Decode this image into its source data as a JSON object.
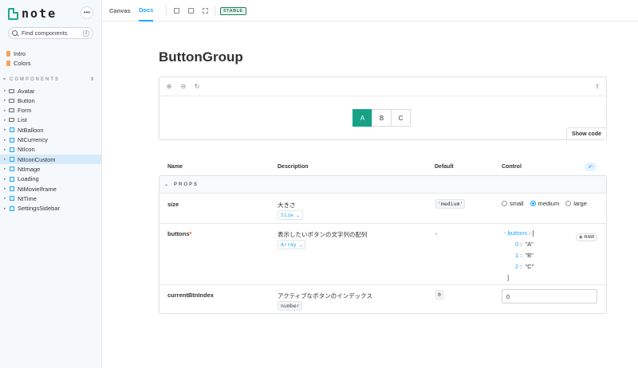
{
  "brand": {
    "name": "note"
  },
  "search": {
    "placeholder": "Find components",
    "shortcut": "/"
  },
  "docs": [
    {
      "label": "Intro"
    },
    {
      "label": "Colors"
    }
  ],
  "sidebar": {
    "section_title": "COMPONENTS",
    "items": [
      {
        "label": "Avatar",
        "type": "folder"
      },
      {
        "label": "Button",
        "type": "folder"
      },
      {
        "label": "Form",
        "type": "folder"
      },
      {
        "label": "List",
        "type": "folder"
      },
      {
        "label": "NtBalloon",
        "type": "component"
      },
      {
        "label": "NtCurrency",
        "type": "component"
      },
      {
        "label": "NtIcon",
        "type": "component"
      },
      {
        "label": "NtIconCustom",
        "type": "component",
        "selected": true
      },
      {
        "label": "NtImage",
        "type": "component"
      },
      {
        "label": "Loading",
        "type": "component"
      },
      {
        "label": "NtMovieIframe",
        "type": "component"
      },
      {
        "label": "NtTime",
        "type": "component"
      },
      {
        "label": "SettingsSidebar",
        "type": "component"
      }
    ]
  },
  "tabs": [
    {
      "label": "Canvas"
    },
    {
      "label": "Docs",
      "active": true
    }
  ],
  "status_badge": "STABLE",
  "page": {
    "title": "ButtonGroup"
  },
  "preview": {
    "buttons": [
      {
        "label": "A",
        "active": true
      },
      {
        "label": "B"
      },
      {
        "label": "C"
      }
    ],
    "show_code": "Show code"
  },
  "table": {
    "headers": {
      "name": "Name",
      "description": "Description",
      "default": "Default",
      "control": "Control"
    },
    "section": "PROPS",
    "rows": {
      "size": {
        "name": "size",
        "description": "大きさ",
        "type": "Size",
        "default": "'medium'",
        "options": [
          {
            "label": "small"
          },
          {
            "label": "medium",
            "checked": true
          },
          {
            "label": "large"
          }
        ]
      },
      "buttons": {
        "name": "buttons",
        "required_mark": "*",
        "description": "表示したいボタンの文字列の配列",
        "type": "Array",
        "default": "-",
        "json_key": "buttons",
        "json_open": "[",
        "json_close": "]",
        "json_items": [
          {
            "index": "0",
            "value": "\"A\""
          },
          {
            "index": "1",
            "value": "\"B\""
          },
          {
            "index": "2",
            "value": "\"C\""
          }
        ],
        "raw_label": "RAW"
      },
      "currentBtnIndex": {
        "name": "currentBtnIndex",
        "description": "アクティブなボタンのインデックス",
        "type": "number",
        "default": "0",
        "value": "0"
      }
    }
  }
}
